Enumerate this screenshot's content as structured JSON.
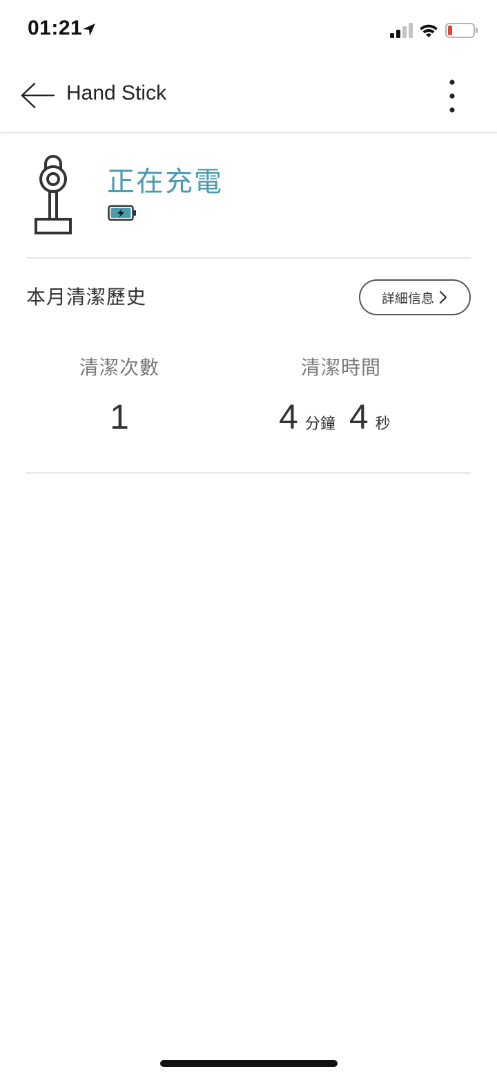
{
  "status_bar": {
    "time": "01:21",
    "icons": [
      "location-arrow-icon",
      "cellular-signal-icon",
      "wifi-icon",
      "battery-low-icon"
    ],
    "battery_color": "#e0443a"
  },
  "app_bar": {
    "title": "Hand Stick",
    "icons": [
      "arrow-left-icon",
      "more-vertical-icon"
    ]
  },
  "device": {
    "icon": "vacuum-stick-icon",
    "status": "正在充電",
    "status_color": "#4a9bae",
    "battery_icon": "battery-charging-icon"
  },
  "history": {
    "title": "本月清潔歷史",
    "details_label": "詳細信息",
    "details_icon": "chevron-right-icon",
    "count_label": "清潔次數",
    "count_value": "1",
    "time_label": "清潔時間",
    "minutes_value": "4",
    "minutes_unit": "分鐘",
    "seconds_value": "4",
    "seconds_unit": "秒"
  }
}
